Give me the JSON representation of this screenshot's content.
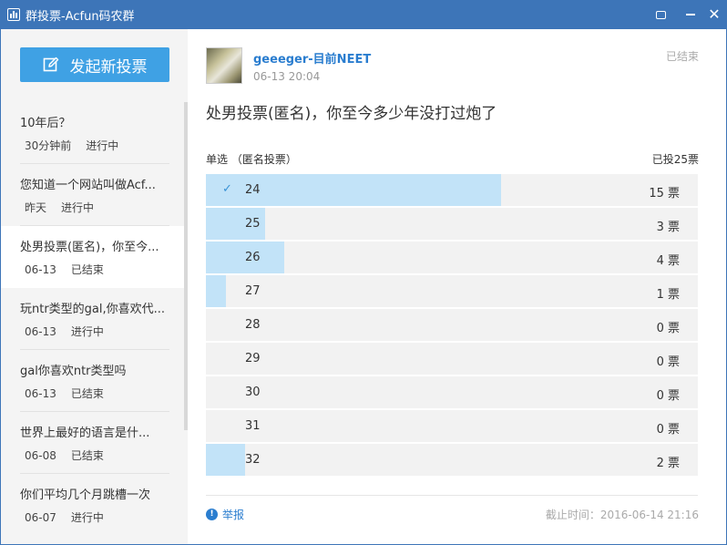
{
  "window": {
    "title": "群投票-Acfun码农群",
    "buttons": [
      "feedback",
      "minimize",
      "close"
    ]
  },
  "sidebar": {
    "new_vote_label": "发起新投票",
    "items": [
      {
        "title": "10年后？",
        "time": "30分钟前",
        "status": "进行中",
        "active": false
      },
      {
        "title": "您知道一个网站叫做Acf...",
        "time": "昨天",
        "status": "进行中",
        "active": false
      },
      {
        "title": "处男投票(匿名)，你至今...",
        "time": "06-13",
        "status": "已结束",
        "active": true
      },
      {
        "title": "玩ntr类型的gal,你喜欢代...",
        "time": "06-13",
        "status": "进行中",
        "active": false
      },
      {
        "title": "gal你喜欢ntr类型吗",
        "time": "06-13",
        "status": "已结束",
        "active": false
      },
      {
        "title": "世界上最好的语言是什...",
        "time": "06-08",
        "status": "已结束",
        "active": false
      },
      {
        "title": "你们平均几个月跳槽一次",
        "time": "06-07",
        "status": "进行中",
        "active": false
      }
    ]
  },
  "poll": {
    "author": "geeeger-目前NEET",
    "post_time": "06-13 20:04",
    "status": "已结束",
    "question": "处男投票(匿名)，你至今多少年没打过炮了",
    "type_label": "单选 （匿名投票）",
    "total_label": "已投25票",
    "total_votes": 25,
    "options": [
      {
        "label": "24",
        "count": "15 票",
        "votes": 15,
        "checked": true
      },
      {
        "label": "25",
        "count": "3 票",
        "votes": 3,
        "checked": false
      },
      {
        "label": "26",
        "count": "4 票",
        "votes": 4,
        "checked": false
      },
      {
        "label": "27",
        "count": "1 票",
        "votes": 1,
        "checked": false
      },
      {
        "label": "28",
        "count": "0 票",
        "votes": 0,
        "checked": false
      },
      {
        "label": "29",
        "count": "0 票",
        "votes": 0,
        "checked": false
      },
      {
        "label": "30",
        "count": "0 票",
        "votes": 0,
        "checked": false
      },
      {
        "label": "31",
        "count": "0 票",
        "votes": 0,
        "checked": false
      },
      {
        "label": "32",
        "count": "2 票",
        "votes": 2,
        "checked": false
      }
    ],
    "report_label": "举报",
    "deadline": "截止时间：2016-06-14 21:16"
  },
  "colors": {
    "titlebar": "#3d75b8",
    "accent": "#3fa1e4",
    "link": "#2a7dcf",
    "bar_fill": "#c2e3f8"
  }
}
